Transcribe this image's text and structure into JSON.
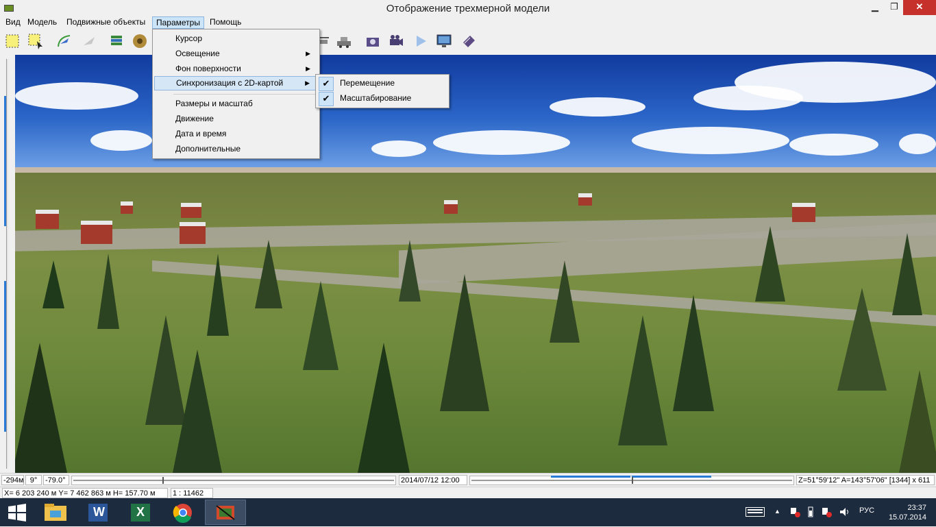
{
  "window": {
    "title": "Отображение трехмерной модели",
    "min_glyph": "▁",
    "max_glyph": "❐",
    "close_glyph": "✕"
  },
  "menubar": [
    "Вид",
    "Модель",
    "Подвижные объекты",
    "Параметры",
    "Помощь"
  ],
  "dropdown": {
    "items": [
      "Курсор",
      "Освещение",
      "Фон поверхности",
      "Синхронизация с 2D-картой",
      "Размеры и масштаб",
      "Движение",
      "Дата и время",
      "Дополнительные"
    ],
    "arrow_glyph": "▶"
  },
  "submenu": {
    "items": [
      "Перемещение",
      "Масштабирование"
    ],
    "check_glyph": "✔"
  },
  "status": {
    "offset": "-294м",
    "tilt": "9°",
    "azimuth": "-79.0°",
    "datetime": "2014/07/12  12:00",
    "coords": "Z=51°59'12\"  A=143°57'06\"  [1344] x 611",
    "position": "X= 6 203 240 м  Y= 7 462 863 м  H= 157.70 м",
    "scale": "1 : 11462"
  },
  "taskbar": {
    "language": "РУС",
    "time": "23:37",
    "date": "15.07.2014",
    "word_glyph": "W",
    "excel_glyph": "X",
    "tray_up_glyph": "▲"
  },
  "colors": {
    "accent": "#2a7ad8",
    "highlight": "#d5e6f6",
    "close": "#c7312b",
    "taskbar": "#1d2b3e"
  }
}
